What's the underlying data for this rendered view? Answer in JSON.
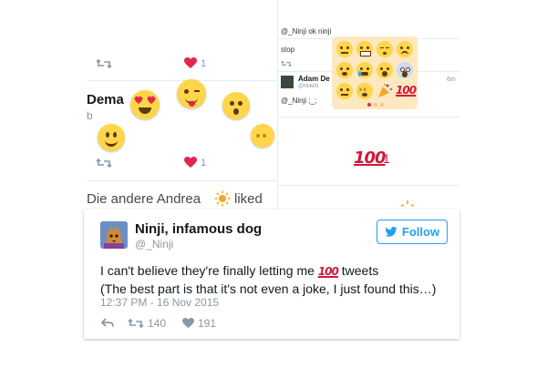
{
  "left_panel": {
    "heart_count": "1",
    "partial_name": "Dema",
    "partial_handle": "b",
    "heart_count_2": "1",
    "activity_name": "Die andere Andrea",
    "activity_verb": "liked"
  },
  "right_panel": {
    "quote_line": "@_Ninji ok ninji",
    "stop_text": "stop",
    "user_name": "Adam De",
    "user_handle": "@hbkirb",
    "reply_text": "@_Ninji ;_;",
    "time_ago": "6m",
    "reaction_count": "1"
  },
  "tweet": {
    "display_name": "Ninji, infamous dog",
    "handle": "@_Ninji",
    "follow_label": "Follow",
    "text_before": "I can't believe they're finally letting me",
    "text_after": "tweets",
    "line2": "(The best part is that it's not even a joke, I just found this…)",
    "timestamp": "12:37 PM - 16 Nov 2015",
    "retweets": "140",
    "likes": "191"
  },
  "icons": [
    "retweet-icon",
    "heart-icon",
    "reply-icon",
    "bird-icon",
    "hundred-points-emoji",
    "sun-icon",
    "gear-icon"
  ],
  "colors": {
    "accent": "#1da1f2",
    "heart": "#e2264d",
    "grey": "#8899a6",
    "emoji_yellow": "#ffd54a",
    "hundred_red": "#d0183b"
  }
}
